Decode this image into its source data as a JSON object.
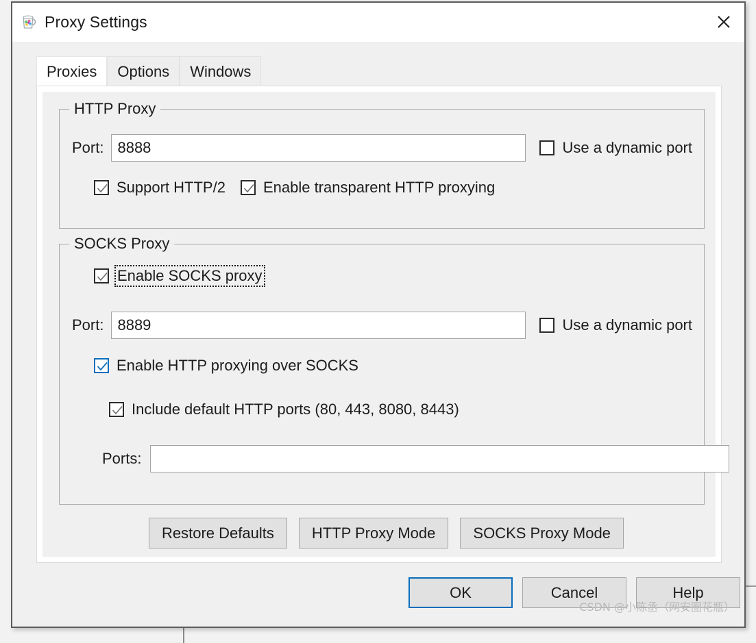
{
  "window": {
    "title": "Proxy Settings",
    "app_icon": "charles-pitcher-icon",
    "close_icon": "close-icon"
  },
  "tabs": [
    {
      "label": "Proxies",
      "active": true
    },
    {
      "label": "Options",
      "active": false
    },
    {
      "label": "Windows",
      "active": false
    }
  ],
  "http_proxy": {
    "group_title": "HTTP Proxy",
    "port_label": "Port:",
    "port_value": "8888",
    "dynamic_port_label": "Use a dynamic port",
    "dynamic_port_checked": false,
    "support_http2_label": "Support HTTP/2",
    "support_http2_checked": true,
    "transparent_label": "Enable transparent HTTP proxying",
    "transparent_checked": true
  },
  "socks_proxy": {
    "group_title": "SOCKS Proxy",
    "enable_label": "Enable SOCKS proxy",
    "enable_checked": true,
    "enable_focused": true,
    "port_label": "Port:",
    "port_value": "8889",
    "dynamic_port_label": "Use a dynamic port",
    "dynamic_port_checked": false,
    "http_over_socks_label": "Enable HTTP proxying over SOCKS",
    "http_over_socks_checked": true,
    "include_default_ports_label": "Include default HTTP ports (80, 443, 8080, 8443)",
    "include_default_ports_checked": true,
    "ports_label": "Ports:",
    "ports_value": "",
    "ports_placeholder": ""
  },
  "mode_buttons": [
    {
      "label": "Restore Defaults"
    },
    {
      "label": "HTTP Proxy Mode"
    },
    {
      "label": "SOCKS Proxy Mode"
    }
  ],
  "dialog_buttons": [
    {
      "label": "OK",
      "default": true
    },
    {
      "label": "Cancel",
      "default": false
    },
    {
      "label": "Help",
      "default": false
    }
  ],
  "watermark": "CSDN @⼩陈丞（网安圈花瓶）",
  "colors": {
    "accent": "#0a6ebd",
    "window_border": "#5c5c5c",
    "panel_bg": "#f0f0f0",
    "button_bg": "#e1e1e1",
    "check_gray": "#6e6e6e"
  }
}
